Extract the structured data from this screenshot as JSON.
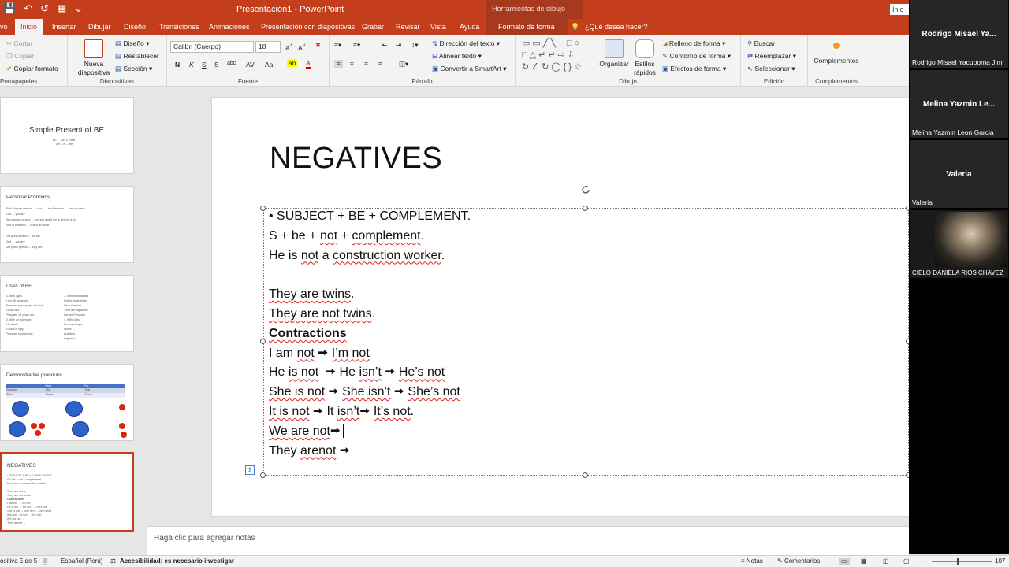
{
  "titlebar": {
    "title": "Presentación1  -  PowerPoint",
    "context_title": "Herramientas de dibujo",
    "signin": "Inic"
  },
  "tabs": [
    {
      "label": "vo"
    },
    {
      "label": "Inicio"
    },
    {
      "label": "Insertar"
    },
    {
      "label": "Dibujar"
    },
    {
      "label": "Diseño"
    },
    {
      "label": "Transiciones"
    },
    {
      "label": "Animaciones"
    },
    {
      "label": "Presentación con diapositivas"
    },
    {
      "label": "Grabar"
    },
    {
      "label": "Revisar"
    },
    {
      "label": "Vista"
    },
    {
      "label": "Ayuda"
    },
    {
      "label": "Formato de forma"
    }
  ],
  "tell_me": "¿Qué desea hacer?",
  "ribbon": {
    "portapapeles": {
      "cortar": "Cortar",
      "copiar": "Copiar",
      "copiar_formato": "Copiar formato",
      "label": "Portapapeles"
    },
    "diapositivas": {
      "nueva1": "Nueva",
      "nueva2": "diapositiva",
      "diseno": "Diseño",
      "restablecer": "Restablecer",
      "seccion": "Sección",
      "label": "Diapositivas"
    },
    "fuente": {
      "font": "Calibri (Cuerpo)",
      "size": "18",
      "label": "Fuente",
      "bold": "N",
      "italic": "K",
      "underline": "S",
      "strike": "S",
      "spacing": "abc",
      "case": "Aa",
      "clear": "A",
      "highlight": "ab",
      "fontcolor": "A"
    },
    "parrafo": {
      "direccion": "Dirección del texto",
      "alinear": "Alinear texto",
      "smartart": "Convertir a SmartArt",
      "label": "Párrafo"
    },
    "dibujo": {
      "organizar": "Organizar",
      "estilos1": "Estilos",
      "estilos2": "rápidos",
      "relleno": "Relleno de forma",
      "contorno": "Contorno de forma",
      "efectos": "Efectos de forma",
      "label": "Dibujo"
    },
    "edicion": {
      "buscar": "Buscar",
      "reemplazar": "Reemplazar",
      "seleccionar": "Seleccionar",
      "label": "Edición"
    },
    "complementos": {
      "btn": "Complementos",
      "label": "Complementos"
    }
  },
  "thumbnails": [
    {
      "title": "Simple Present of BE",
      "lines": [
        "BE → Ser o Estar",
        "Am – is – are"
      ]
    },
    {
      "title": "Personal Pronouns",
      "lines": [
        "First singular person → I am → I am Peruvian → I am at home.",
        "2nd → you are",
        "3rd singular person → he, she and it (he is, she is, it is)",
        "She is beautiful → She is at home.",
        "",
        "1st plural person → we are",
        "2nd → you are",
        "3rd plural person → they are"
      ]
    },
    {
      "title": "Uses of BE",
      "col1": [
        "1.   With ages.",
        "I am 36 years old.",
        "Francesca is 6 years old and",
        "Lucas is 4.",
        "They are 10 years old.",
        "2. With an adjective.",
        " He is tall.",
        "Carlos is ugly.",
        "They are kind people."
      ],
      "col2": [
        "3. With nationalities.",
        "She is Argentinian.",
        "He is German.",
        "They are Japanese.",
        "We are Peruvian.",
        "4. With Jobs",
        "He is a Lawyer",
        "Nurse",
        "Architect",
        "engineer"
      ]
    },
    {
      "title": "Demonstrative pronouns",
      "headers": [
        "",
        "Near",
        "Far"
      ],
      "rows": [
        [
          "Singular",
          "This",
          "That"
        ],
        [
          "Plural",
          "These",
          "Those"
        ]
      ]
    },
    {
      "title": "NEGATIVES",
      "lines": [
        "• SUBJECT + BE + COMPLEMENT.",
        "S + be + not + complement.",
        "He is not a construction worker.",
        "",
        "They are twins.",
        "They are not twins.",
        "Contractions",
        "I am not → I’m not",
        "He is not → He isn’t → He’s not",
        "She is not → She isn’t → She’s not",
        "It is not → It isn’t → It’s not.",
        "We are not →",
        "They arenot →"
      ]
    }
  ],
  "slide": {
    "title": "NEGATIVES",
    "lines": [
      "•  SUBJECT + BE + COMPLEMENT.",
      "S + be + not + complement.",
      "He is not a construction worker.",
      "",
      "They are twins.",
      "They are not twins.",
      "Contractions",
      "I am not → I’m not",
      "He is not  → He isn’t → He’s not",
      "She is not → She isn’t → She’s not",
      "It is not → It isn’t→ It’s not.",
      "We are not→",
      "They arenot →"
    ]
  },
  "notes_placeholder": "Haga clic para agregar notas",
  "statusbar": {
    "slide": "ositiva 5 de 5",
    "language": "Español (Perú)",
    "accessibility": "Accesibilidad: es necesario investigar",
    "notes": "Notas",
    "comments": "Comentarios",
    "zoom": "107"
  },
  "participants": [
    {
      "big": "Rodrigo Misael Ya...",
      "small": "Rodrigo Misael Yacupoma Jim"
    },
    {
      "big": "Melina Yazmin Le...",
      "small": "Melina Yazmin Leon Garcia"
    },
    {
      "big": "Valeria",
      "small": "Valeria"
    },
    {
      "big": "",
      "small": "CIELO DANIELA RIOS CHAVEZ"
    }
  ],
  "colors": {
    "accent": "#c43e1c",
    "ribbon": "#f3f3f3",
    "squiggle": "#dd2222"
  }
}
